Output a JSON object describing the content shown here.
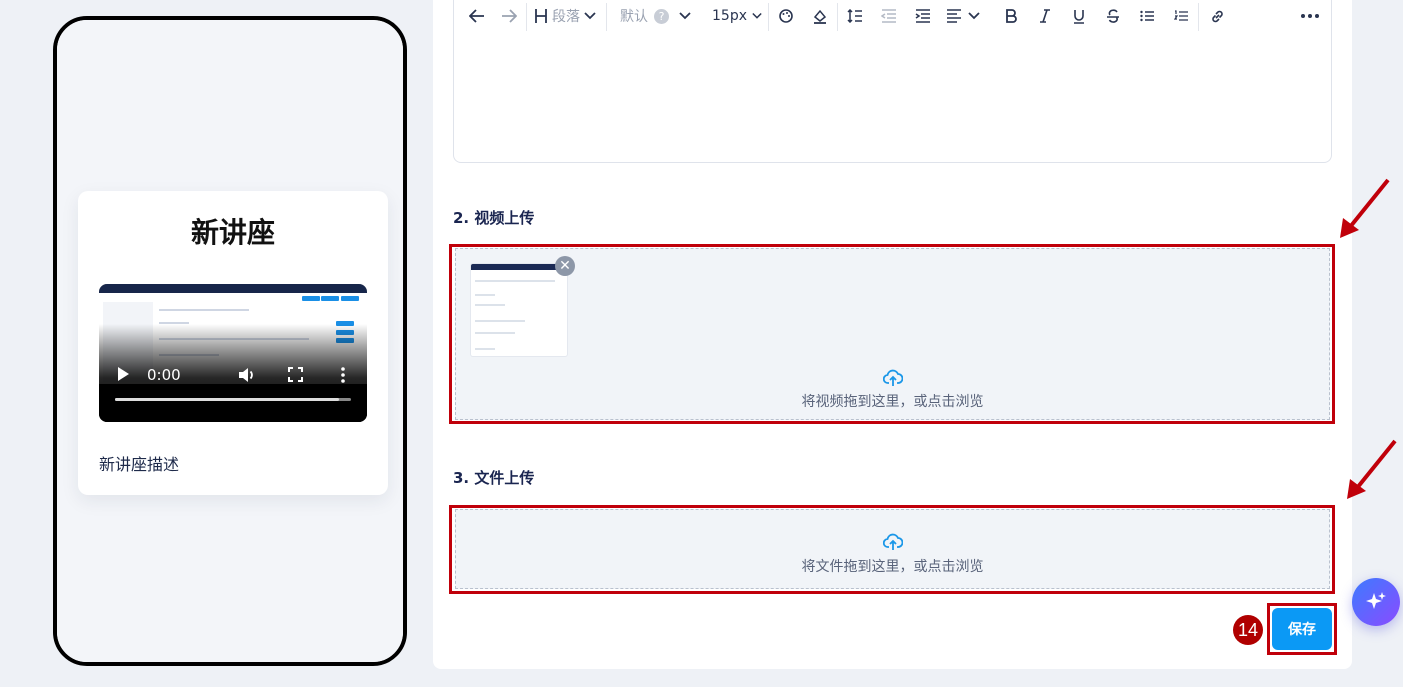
{
  "preview": {
    "title": "新讲座",
    "video_time": "0:00",
    "description": "新讲座描述"
  },
  "toolbar": {
    "heading_label": "段落",
    "font_label": "默认",
    "font_help": "?",
    "size_label": "15px"
  },
  "video_section": {
    "title": "2. 视频上传",
    "drop_text": "将视频拖到这里，或点击浏览",
    "remove_glyph": "✕"
  },
  "file_section": {
    "title": "3. 文件上传",
    "drop_text": "将文件拖到这里，或点击浏览"
  },
  "save_label": "保存",
  "step_badge": "14",
  "colors": {
    "accent": "#0b99f5",
    "highlight": "#c0000a",
    "badge": "#b00000"
  },
  "icons": [
    "undo-icon",
    "redo-icon",
    "heading-icon",
    "chevron-down-icon",
    "palette-icon",
    "highlight-icon",
    "line-height-icon",
    "outdent-icon",
    "indent-icon",
    "align-icon",
    "bold-icon",
    "italic-icon",
    "underline-icon",
    "strikethrough-icon",
    "bullet-list-icon",
    "numbered-list-icon",
    "link-icon",
    "more-icon",
    "upload-icon",
    "sparkle-icon",
    "play-icon",
    "volume-icon",
    "fullscreen-icon",
    "kebab-icon"
  ]
}
